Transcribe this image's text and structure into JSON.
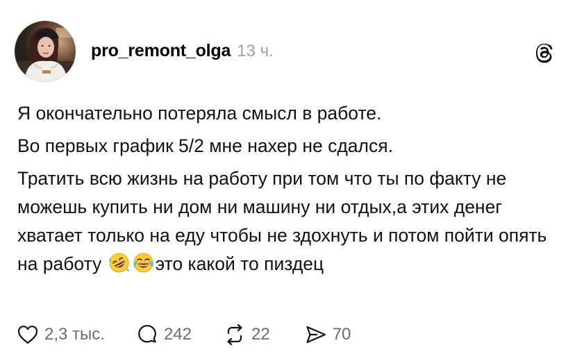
{
  "post": {
    "username": "pro_remont_olga",
    "timestamp": "13 ч.",
    "paragraphs": {
      "p1": "Я окончательно потеряла смысл в работе.",
      "p2": "Во первых график 5/2 мне нахер не сдался.",
      "p3": "Тратить всю жизнь на работу при том что ты по факту не можешь купить ни дом ни машину ни отдых,а этих денег хватает только на еду чтобы не здохнуть и потом пойти опять на работу ",
      "p3_tail": "это какой то пиздец"
    },
    "emojis": [
      "rolling-on-the-floor-laughing-emoji",
      "face-with-tears-of-joy-emoji"
    ]
  },
  "actions": {
    "likes": "2,3 тыс.",
    "replies": "242",
    "reposts": "22",
    "shares": "70"
  },
  "icons": {
    "brand": "threads-logo-icon",
    "like": "heart-icon",
    "reply": "speech-bubble-icon",
    "repost": "repost-arrows-icon",
    "share": "send-icon"
  }
}
